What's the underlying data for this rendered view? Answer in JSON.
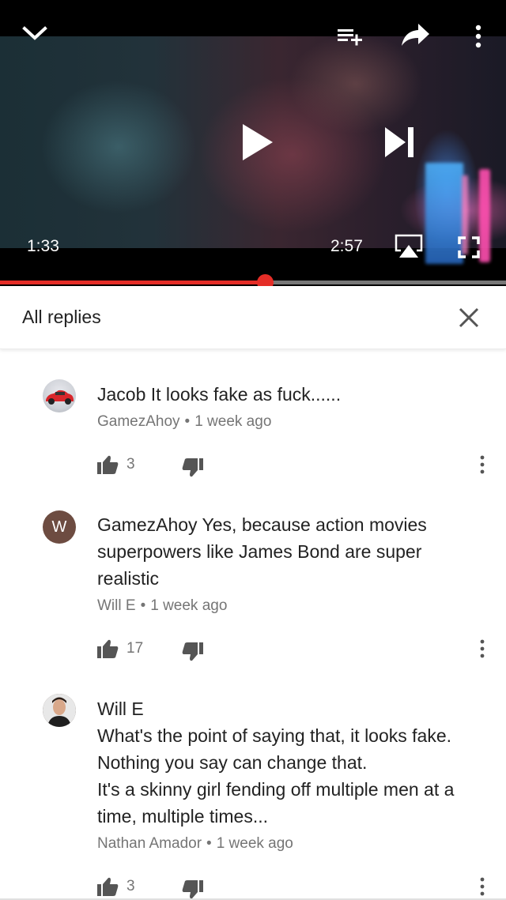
{
  "player": {
    "current_time": "1:33",
    "total_time": "2:57",
    "progress_fraction": 0.524,
    "icons": {
      "collapse": "chevron-down-icon",
      "add_to_playlist": "playlist-add-icon",
      "share": "share-arrow-icon",
      "more": "more-vert-icon",
      "play": "play-icon",
      "next": "skip-next-icon",
      "airplay": "airplay-icon",
      "fullscreen": "fullscreen-icon"
    }
  },
  "replies_panel": {
    "title": "All replies",
    "close_icon": "close-icon"
  },
  "comments": [
    {
      "lines": [
        "Jacob It looks fake as fuck......"
      ],
      "author": "GamezAhoy",
      "time": "1 week ago",
      "likes": "3",
      "avatar": "car-avatar"
    },
    {
      "lines": [
        "GamezAhoy Yes, because action movies",
        "superpowers like James Bond are super",
        "realistic"
      ],
      "author": "Will E",
      "time": "1 week ago",
      "likes": "17",
      "avatar_letter": "W"
    },
    {
      "lines": [
        "Will E",
        "What's the point of saying that, it looks fake.",
        "Nothing you say can change that.",
        "It's a skinny girl fending off multiple men at a",
        "time, multiple times..."
      ],
      "author": "Nathan Amador",
      "time": "1 week ago",
      "likes": "3",
      "avatar": "man-avatar"
    }
  ],
  "colors": {
    "accent_red": "#e52d27",
    "meta_gray": "#757575",
    "avatar_brown": "#6d4c41"
  }
}
